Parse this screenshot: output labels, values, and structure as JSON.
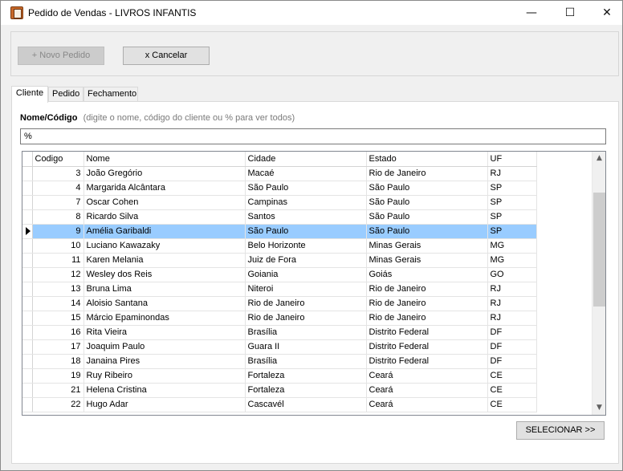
{
  "window": {
    "title": "Pedido de Vendas - LIVROS INFANTIS",
    "minimize_glyph": "—",
    "maximize_glyph": "☐",
    "close_glyph": "✕"
  },
  "toolbar": {
    "novo_label": "+ Novo Pedido",
    "cancelar_label": "x Cancelar"
  },
  "tabs": [
    {
      "label": "Cliente",
      "active": true
    },
    {
      "label": "Pedido",
      "active": false
    },
    {
      "label": "Fechamento",
      "active": false
    }
  ],
  "search": {
    "label": "Nome/Código",
    "hint": "(digite o nome, código do cliente ou % para ver todos)",
    "value": "%"
  },
  "grid": {
    "columns": [
      "Codigo",
      "Nome",
      "Cidade",
      "Estado",
      "UF"
    ],
    "selected_index": 4,
    "rows": [
      [
        "3",
        "João Gregório",
        "Macaé",
        "Rio de Janeiro",
        "RJ"
      ],
      [
        "4",
        "Margarida Alcântara",
        "São Paulo",
        "São Paulo",
        "SP"
      ],
      [
        "7",
        "Oscar Cohen",
        "Campinas",
        "São Paulo",
        "SP"
      ],
      [
        "8",
        "Ricardo Silva",
        "Santos",
        "São Paulo",
        "SP"
      ],
      [
        "9",
        "Amélia Garibaldi",
        "São Paulo",
        "São Paulo",
        "SP"
      ],
      [
        "10",
        "Luciano Kawazaky",
        "Belo Horizonte",
        "Minas Gerais",
        "MG"
      ],
      [
        "11",
        "Karen Melania",
        "Juiz de Fora",
        "Minas Gerais",
        "MG"
      ],
      [
        "12",
        "Wesley dos Reis",
        "Goiania",
        "Goiás",
        "GO"
      ],
      [
        "13",
        "Bruna Lima",
        "Niteroi",
        "Rio de Janeiro",
        "RJ"
      ],
      [
        "14",
        "Aloisio Santana",
        "Rio de Janeiro",
        "Rio de Janeiro",
        "RJ"
      ],
      [
        "15",
        "Márcio Epaminondas",
        "Rio de Janeiro",
        "Rio de Janeiro",
        "RJ"
      ],
      [
        "16",
        "Rita Vieira",
        "Brasília",
        "Distrito Federal",
        "DF"
      ],
      [
        "17",
        "Joaquim Paulo",
        "Guara II",
        "Distrito Federal",
        "DF"
      ],
      [
        "18",
        "Janaina Pires",
        "Brasília",
        "Distrito Federal",
        "DF"
      ],
      [
        "19",
        "Ruy Ribeiro",
        "Fortaleza",
        "Ceará",
        "CE"
      ],
      [
        "21",
        "Helena Cristina",
        "Fortaleza",
        "Ceará",
        "CE"
      ],
      [
        "22",
        "Hugo Adar",
        "Cascavél",
        "Ceará",
        "CE"
      ]
    ]
  },
  "actions": {
    "selecionar_label": "SELECIONAR >>"
  },
  "colors": {
    "selected_row": "#99ccff",
    "window_bg": "#f0f0f0",
    "grid_lines": "#e4e4e4"
  }
}
